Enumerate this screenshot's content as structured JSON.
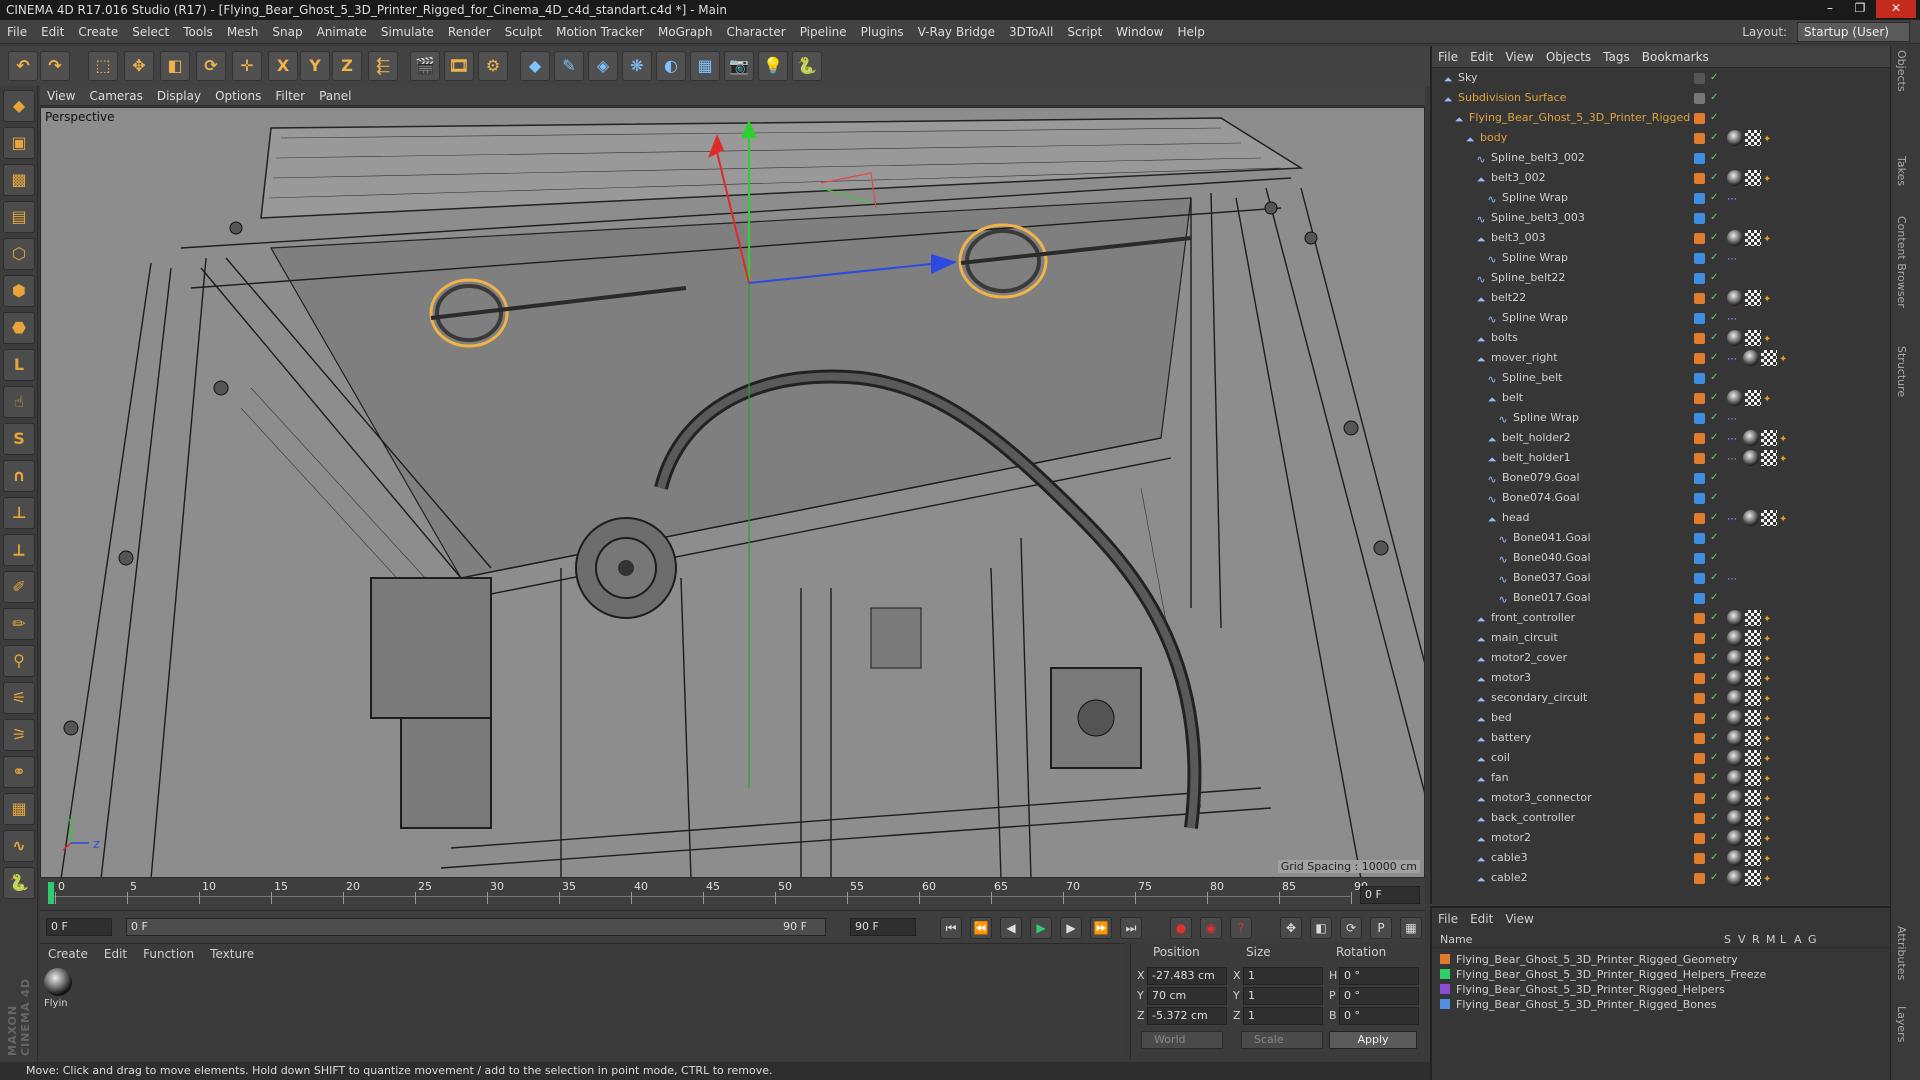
{
  "window": {
    "title": "CINEMA 4D R17.016 Studio (R17) - [Flying_Bear_Ghost_5_3D_Printer_Rigged_for_Cinema_4D_c4d_standart.c4d *] - Main",
    "controls": [
      "–",
      "❐",
      "✕"
    ]
  },
  "menubar": [
    "File",
    "Edit",
    "Create",
    "Select",
    "Tools",
    "Mesh",
    "Snap",
    "Animate",
    "Simulate",
    "Render",
    "Sculpt",
    "Motion Tracker",
    "MoGraph",
    "Character",
    "Pipeline",
    "Plugins",
    "V-Ray Bridge",
    "3DToAll",
    "Script",
    "Window",
    "Help"
  ],
  "layout": {
    "label": "Layout:",
    "value": "Startup (User)"
  },
  "toolbar": [
    {
      "name": "undo-icon",
      "glyph": "↶"
    },
    {
      "name": "redo-icon",
      "glyph": "↷"
    },
    {
      "name": "live-selection-icon",
      "glyph": "⬚"
    },
    {
      "name": "move-icon",
      "glyph": "✥"
    },
    {
      "name": "scale-icon",
      "glyph": "◧"
    },
    {
      "name": "rotate-icon",
      "glyph": "⟳"
    },
    {
      "name": "recent-tool-icon",
      "glyph": "✛"
    },
    {
      "name": "x-axis-icon",
      "glyph": "X"
    },
    {
      "name": "y-axis-icon",
      "glyph": "Y"
    },
    {
      "name": "z-axis-icon",
      "glyph": "Z"
    },
    {
      "name": "coordinate-system-icon",
      "glyph": "⬱"
    },
    {
      "name": "render-view-icon",
      "glyph": "🎬"
    },
    {
      "name": "render-picture-viewer-icon",
      "glyph": "🎞"
    },
    {
      "name": "render-settings-icon",
      "glyph": "⚙"
    },
    {
      "name": "cube-icon",
      "glyph": "◆"
    },
    {
      "name": "pen-icon",
      "glyph": "✎"
    },
    {
      "name": "subdivision-icon",
      "glyph": "◈"
    },
    {
      "name": "cloner-icon",
      "glyph": "❋"
    },
    {
      "name": "deformer-icon",
      "glyph": "◐"
    },
    {
      "name": "floor-icon",
      "glyph": "▦"
    },
    {
      "name": "camera-icon",
      "glyph": "📷"
    },
    {
      "name": "light-icon",
      "glyph": "💡"
    },
    {
      "name": "python-icon",
      "glyph": "🐍"
    }
  ],
  "left_tools": [
    {
      "name": "make-editable-icon",
      "glyph": "◆"
    },
    {
      "name": "model-mode-icon",
      "glyph": "▣"
    },
    {
      "name": "texture-mode-icon",
      "glyph": "▩"
    },
    {
      "name": "workplane-icon",
      "glyph": "▤"
    },
    {
      "name": "points-mode-icon",
      "glyph": "⬡"
    },
    {
      "name": "edges-mode-icon",
      "glyph": "⬢"
    },
    {
      "name": "polygons-mode-icon",
      "glyph": "⬣"
    },
    {
      "name": "axis-mode-icon",
      "glyph": "L"
    },
    {
      "name": "tweak-mode-icon",
      "glyph": "☝"
    },
    {
      "name": "snap-icon",
      "glyph": "S"
    },
    {
      "name": "magnet-icon",
      "glyph": "∩"
    },
    {
      "name": "joint-tool-icon",
      "glyph": "⊥"
    },
    {
      "name": "ik-chain-icon",
      "glyph": "⟂"
    },
    {
      "name": "weight-tool-icon",
      "glyph": "✐"
    },
    {
      "name": "paint-tool-icon",
      "glyph": "✏"
    },
    {
      "name": "bind-icon",
      "glyph": "⚲"
    },
    {
      "name": "brush-icon",
      "glyph": "⚟"
    },
    {
      "name": "smooth-icon",
      "glyph": "⚞"
    },
    {
      "name": "pose-icon",
      "glyph": "⚭"
    },
    {
      "name": "grid-lock-icon",
      "glyph": "▦"
    },
    {
      "name": "spline-tool-icon",
      "glyph": "∿"
    },
    {
      "name": "python-icon",
      "glyph": "🐍"
    }
  ],
  "maxon_logo": "MAXON CINEMA 4D",
  "viewport": {
    "menu": [
      "View",
      "Cameras",
      "Display",
      "Options",
      "Filter",
      "Panel"
    ],
    "label": "Perspective",
    "grid_spacing": "Grid Spacing : 10000 cm"
  },
  "timeline": {
    "ticks": [
      "0",
      "5",
      "10",
      "15",
      "20",
      "25",
      "30",
      "35",
      "40",
      "45",
      "50",
      "55",
      "60",
      "65",
      "70",
      "75",
      "80",
      "85",
      "90"
    ],
    "current_frame": "0 F"
  },
  "transport": {
    "start": "0 F",
    "range_start": "0 F",
    "range_end": "90 F",
    "end": "90 F"
  },
  "material_manager": {
    "menu": [
      "Create",
      "Edit",
      "Function",
      "Texture"
    ],
    "material_name": "Flyin"
  },
  "coordinates": {
    "headers": {
      "position": "Position",
      "size": "Size",
      "rotation": "Rotation"
    },
    "rows": [
      {
        "axis": "X",
        "pos": "-27.483 cm",
        "size": "1",
        "rot_label": "H",
        "rot": "0 °"
      },
      {
        "axis": "Y",
        "pos": "70 cm",
        "size": "1",
        "rot_label": "P",
        "rot": "0 °"
      },
      {
        "axis": "Z",
        "pos": "-5.372 cm",
        "size": "1",
        "rot_label": "B",
        "rot": "0 °"
      }
    ],
    "world": "World",
    "scale": "Scale",
    "apply": "Apply"
  },
  "status": "Move: Click and drag to move elements. Hold down SHIFT to quantize movement / add to the selection in point mode, CTRL to remove.",
  "objects_panel": {
    "menu": [
      "File",
      "Edit",
      "View",
      "Objects",
      "Tags",
      "Bookmarks"
    ],
    "rows": [
      {
        "name": "Sky",
        "indent": 0,
        "color": "#cfcfcf",
        "dot": "#555",
        "tags": ""
      },
      {
        "name": "Subdivision Surface",
        "indent": 0,
        "color": "#e0a23c",
        "dot": "#777",
        "tags": ""
      },
      {
        "name": "Flying_Bear_Ghost_5_3D_Printer_Rigged",
        "indent": 1,
        "color": "#e0a23c",
        "dot": "#e07a2c",
        "tags": ""
      },
      {
        "name": "body",
        "indent": 2,
        "color": "#e0a23c",
        "dot": "#e07a2c",
        "tags": "mat chk ik"
      },
      {
        "name": "Spline_belt3_002",
        "indent": 3,
        "color": "#cfcfcf",
        "dot": "#3d8ee0",
        "tags": ""
      },
      {
        "name": "belt3_002",
        "indent": 3,
        "color": "#cfcfcf",
        "dot": "#e07a2c",
        "tags": "mat chk ik"
      },
      {
        "name": "Spline Wrap",
        "indent": 4,
        "color": "#cfcfcf",
        "dot": "#3d8ee0",
        "tags": "sp"
      },
      {
        "name": "Spline_belt3_003",
        "indent": 3,
        "color": "#cfcfcf",
        "dot": "#3d8ee0",
        "tags": ""
      },
      {
        "name": "belt3_003",
        "indent": 3,
        "color": "#cfcfcf",
        "dot": "#e07a2c",
        "tags": "mat chk ik"
      },
      {
        "name": "Spline Wrap",
        "indent": 4,
        "color": "#cfcfcf",
        "dot": "#3d8ee0",
        "tags": "sp"
      },
      {
        "name": "Spline_belt22",
        "indent": 3,
        "color": "#cfcfcf",
        "dot": "#3d8ee0",
        "tags": ""
      },
      {
        "name": "belt22",
        "indent": 3,
        "color": "#cfcfcf",
        "dot": "#e07a2c",
        "tags": "mat chk ik"
      },
      {
        "name": "Spline Wrap",
        "indent": 4,
        "color": "#cfcfcf",
        "dot": "#3d8ee0",
        "tags": "sp"
      },
      {
        "name": "bolts",
        "indent": 3,
        "color": "#cfcfcf",
        "dot": "#e07a2c",
        "tags": "mat chk ik"
      },
      {
        "name": "mover_right",
        "indent": 3,
        "color": "#cfcfcf",
        "dot": "#e07a2c",
        "tags": "sp mat chk ik"
      },
      {
        "name": "Spline_belt",
        "indent": 4,
        "color": "#cfcfcf",
        "dot": "#3d8ee0",
        "tags": ""
      },
      {
        "name": "belt",
        "indent": 4,
        "color": "#cfcfcf",
        "dot": "#e07a2c",
        "tags": "mat chk ik"
      },
      {
        "name": "Spline Wrap",
        "indent": 5,
        "color": "#cfcfcf",
        "dot": "#3d8ee0",
        "tags": "sp"
      },
      {
        "name": "belt_holder2",
        "indent": 4,
        "color": "#cfcfcf",
        "dot": "#e07a2c",
        "tags": "sp mat chk ik"
      },
      {
        "name": "belt_holder1",
        "indent": 4,
        "color": "#cfcfcf",
        "dot": "#e07a2c",
        "tags": "sp mat chk ik"
      },
      {
        "name": "Bone079.Goal",
        "indent": 4,
        "color": "#cfcfcf",
        "dot": "#3d8ee0",
        "tags": ""
      },
      {
        "name": "Bone074.Goal",
        "indent": 4,
        "color": "#cfcfcf",
        "dot": "#3d8ee0",
        "tags": ""
      },
      {
        "name": "head",
        "indent": 4,
        "color": "#cfcfcf",
        "dot": "#e07a2c",
        "tags": "sp mat chk ik"
      },
      {
        "name": "Bone041.Goal",
        "indent": 5,
        "color": "#cfcfcf",
        "dot": "#3d8ee0",
        "tags": ""
      },
      {
        "name": "Bone040.Goal",
        "indent": 5,
        "color": "#cfcfcf",
        "dot": "#3d8ee0",
        "tags": ""
      },
      {
        "name": "Bone037.Goal",
        "indent": 5,
        "color": "#cfcfcf",
        "dot": "#3d8ee0",
        "tags": "sp"
      },
      {
        "name": "Bone017.Goal",
        "indent": 5,
        "color": "#cfcfcf",
        "dot": "#3d8ee0",
        "tags": ""
      },
      {
        "name": "front_controller",
        "indent": 3,
        "color": "#cfcfcf",
        "dot": "#e07a2c",
        "tags": "mat chk ik"
      },
      {
        "name": "main_circuit",
        "indent": 3,
        "color": "#cfcfcf",
        "dot": "#e07a2c",
        "tags": "mat chk ik"
      },
      {
        "name": "motor2_cover",
        "indent": 3,
        "color": "#cfcfcf",
        "dot": "#e07a2c",
        "tags": "mat chk ik"
      },
      {
        "name": "motor3",
        "indent": 3,
        "color": "#cfcfcf",
        "dot": "#e07a2c",
        "tags": "mat chk ik"
      },
      {
        "name": "secondary_circuit",
        "indent": 3,
        "color": "#cfcfcf",
        "dot": "#e07a2c",
        "tags": "mat chk ik"
      },
      {
        "name": "bed",
        "indent": 3,
        "color": "#cfcfcf",
        "dot": "#e07a2c",
        "tags": "mat chk ik"
      },
      {
        "name": "battery",
        "indent": 3,
        "color": "#cfcfcf",
        "dot": "#e07a2c",
        "tags": "mat chk ik"
      },
      {
        "name": "coil",
        "indent": 3,
        "color": "#cfcfcf",
        "dot": "#e07a2c",
        "tags": "mat chk ik"
      },
      {
        "name": "fan",
        "indent": 3,
        "color": "#cfcfcf",
        "dot": "#e07a2c",
        "tags": "mat chk ik"
      },
      {
        "name": "motor3_connector",
        "indent": 3,
        "color": "#cfcfcf",
        "dot": "#e07a2c",
        "tags": "mat chk ik"
      },
      {
        "name": "back_controller",
        "indent": 3,
        "color": "#cfcfcf",
        "dot": "#e07a2c",
        "tags": "mat chk ik"
      },
      {
        "name": "motor2",
        "indent": 3,
        "color": "#cfcfcf",
        "dot": "#e07a2c",
        "tags": "mat chk ik"
      },
      {
        "name": "cable3",
        "indent": 3,
        "color": "#cfcfcf",
        "dot": "#e07a2c",
        "tags": "mat chk ik"
      },
      {
        "name": "cable2",
        "indent": 3,
        "color": "#cfcfcf",
        "dot": "#e07a2c",
        "tags": "mat chk ik"
      }
    ]
  },
  "layers_panel": {
    "menu": [
      "File",
      "Edit",
      "View"
    ],
    "columns": [
      "Name",
      "S",
      "V",
      "R",
      "M",
      "L",
      "A",
      "G"
    ],
    "rows": [
      {
        "name": "Flying_Bear_Ghost_5_3D_Printer_Rigged_Geometry",
        "color": "#e07a2c"
      },
      {
        "name": "Flying_Bear_Ghost_5_3D_Printer_Rigged_Helpers_Freeze",
        "color": "#2fd06a"
      },
      {
        "name": "Flying_Bear_Ghost_5_3D_Printer_Rigged_Helpers",
        "color": "#8a4fd0"
      },
      {
        "name": "Flying_Bear_Ghost_5_3D_Printer_Rigged_Bones",
        "color": "#4f8ee0"
      }
    ]
  },
  "right_tabs": [
    "Objects",
    "Takes",
    "Content Browser",
    "Structure",
    "Attributes",
    "Layers"
  ]
}
